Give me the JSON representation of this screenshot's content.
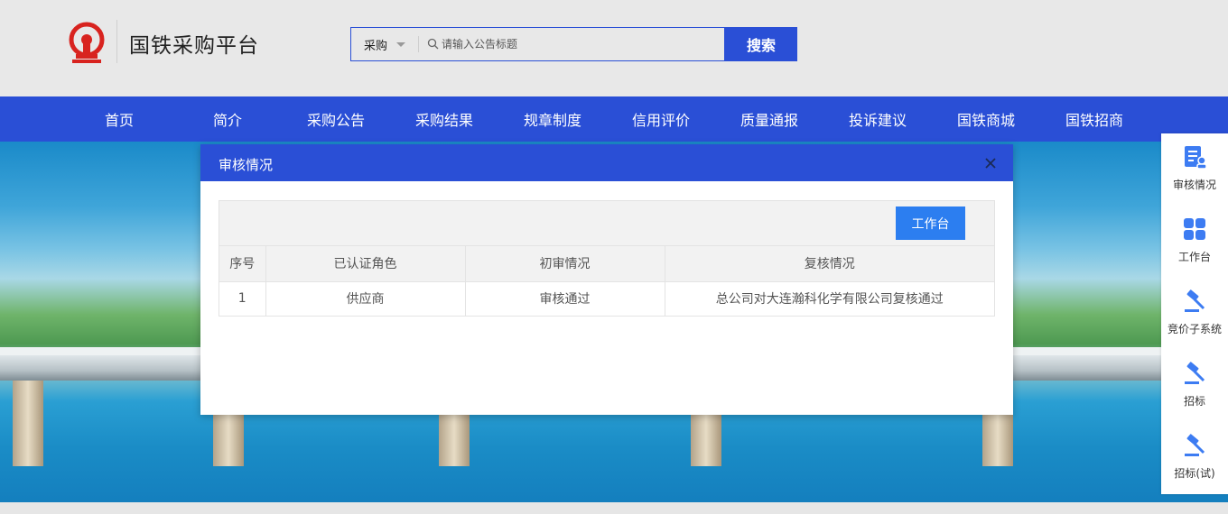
{
  "header": {
    "brand": "国铁采购平台",
    "search": {
      "category": "采购",
      "placeholder": "请输入公告标题",
      "button": "搜索"
    }
  },
  "nav": {
    "items": [
      "首页",
      "简介",
      "采购公告",
      "采购结果",
      "规章制度",
      "信用评价",
      "质量通报",
      "投诉建议",
      "国铁商城",
      "国铁招商"
    ]
  },
  "sidebar": {
    "items": [
      {
        "label": "审核情况",
        "icon": "audit-doc-icon"
      },
      {
        "label": "工作台",
        "icon": "grid-icon"
      },
      {
        "label": "竞价子系统",
        "icon": "gavel-icon"
      },
      {
        "label": "招标",
        "icon": "gavel-icon"
      },
      {
        "label": "招标(试)",
        "icon": "gavel-icon"
      }
    ]
  },
  "modal": {
    "title": "审核情况",
    "workbench_button": "工作台",
    "table": {
      "headers": [
        "序号",
        "已认证角色",
        "初审情况",
        "复核情况"
      ],
      "rows": [
        [
          "1",
          "供应商",
          "审核通过",
          "总公司对大连瀚科化学有限公司复核通过"
        ]
      ]
    }
  },
  "colors": {
    "primary": "#2a4fd6",
    "button_blue": "#2c7ef0",
    "logo_red": "#d8231f",
    "icon_blue": "#3d7cf2"
  }
}
